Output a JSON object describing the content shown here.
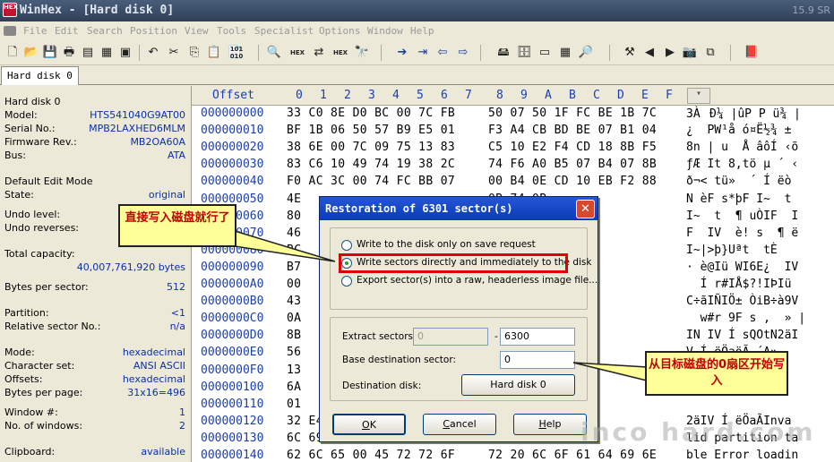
{
  "window": {
    "title": "WinHex - [Hard disk 0]",
    "version": "15.9 SR",
    "app_icon_text": "HEX"
  },
  "menu": [
    "File",
    "Edit",
    "Search",
    "Position",
    "View",
    "Tools",
    "Specialist",
    "Options",
    "Window",
    "Help"
  ],
  "tab": {
    "label": "Hard disk 0"
  },
  "left_panel": {
    "heading": "Hard disk 0",
    "rows": [
      {
        "label": "Model:",
        "value": "HTS541040G9AT00"
      },
      {
        "label": "Serial No.:",
        "value": "MPB2LAXHED6MLM"
      },
      {
        "label": "Firmware Rev.:",
        "value": "MB2OA60A"
      },
      {
        "label": "Bus:",
        "value": "ATA"
      },
      {
        "label": "Default Edit Mode",
        "value": ""
      },
      {
        "label": "State:",
        "value": "original"
      },
      {
        "label": "Undo level:",
        "value": ""
      },
      {
        "label": "Undo reverses:",
        "value": ""
      },
      {
        "label": "Total capacity:",
        "value": ""
      },
      {
        "label": "",
        "value": "40,007,761,920 bytes"
      },
      {
        "label": "Bytes per sector:",
        "value": "512"
      },
      {
        "label": "Partition:",
        "value": "<1"
      },
      {
        "label": "Relative sector No.:",
        "value": "n/a"
      },
      {
        "label": "Mode:",
        "value": "hexadecimal"
      },
      {
        "label": "Character set:",
        "value": "ANSI ASCII"
      },
      {
        "label": "Offsets:",
        "value": "hexadecimal"
      },
      {
        "label": "Bytes per page:",
        "value": "31x16=496"
      },
      {
        "label": "Window #:",
        "value": "1"
      },
      {
        "label": "No. of windows:",
        "value": "2"
      },
      {
        "label": "Clipboard:",
        "value": "available"
      }
    ]
  },
  "hex": {
    "offset_header": "Offset",
    "columns": [
      "0",
      "1",
      "2",
      "3",
      "4",
      "5",
      "6",
      "7",
      "8",
      "9",
      "A",
      "B",
      "C",
      "D",
      "E",
      "F"
    ],
    "rows": [
      {
        "offset": "000000000",
        "hex_left": "33 C0 8E D0 BC 00 7C FB",
        "hex_right": "50 07 50 1F FC BE 1B 7C",
        "ascii": "3ÀĐ¼ |ûP P ü¾ |"
      },
      {
        "offset": "000000010",
        "hex_left": "BF 1B 06 50 57 B9 E5 01",
        "hex_right": "F3 A4 CB BD BE 07 B1 04",
        "ascii": "¿  PW¹å ó¤Ë½¾ ±"
      },
      {
        "offset": "000000020",
        "hex_left": "38 6E 00 7C 09 75 13 83",
        "hex_right": "C5 10 E2 F4 CD 18 8B F5",
        "ascii": "8n | u  Å âôÍ ‹õ"
      },
      {
        "offset": "000000030",
        "hex_left": "83 C6 10 49 74 19 38 2C",
        "hex_right": "74 F6 A0 B5 07 B4 07 8B",
        "ascii": "ƒÆ It 8,tö µ ´ ‹"
      },
      {
        "offset": "000000040",
        "hex_left": "F0 AC 3C 00 74 FC BB 07",
        "hex_right": "00 B4 0E CD 10 EB F2 88",
        "ascii": "ð¬< tü»  ´ Í ëò"
      },
      {
        "offset": "000000050",
        "hex_left": "4E",
        "hex_right": "0B 74 0B",
        "ascii": "N èF s*þF I~  t"
      },
      {
        "offset": "000000060",
        "hex_left": "80",
        "hex_right": "02 06 83",
        "ascii": "I~  t  ¶ uÒIF  I"
      },
      {
        "offset": "000000070",
        "hex_left": "46",
        "hex_right": "B6 07 EB",
        "ascii": "F  IV  è! s  ¶ ë"
      },
      {
        "offset": "000000080",
        "hex_left": "BC",
        "hex_right": "74 C8 A0",
        "ascii": "I~|>þ}Uªt  tÈ "
      },
      {
        "offset": "000000090",
        "hex_left": "B7",
        "hex_right": "00 8A 56",
        "ascii": "· è@Iü WI6E¿  IV"
      },
      {
        "offset": "0000000A0",
        "hex_left": "00",
        "hex_right": "DE 8A FC",
        "ascii": "  Í r#IÅ$?!IÞIü"
      },
      {
        "offset": "0000000B0",
        "hex_left": "43",
        "hex_right": "F7 E1 8B",
        "ascii": "C÷ãIÑIÖ± ÒiB÷à9V"
      },
      {
        "offset": "0000000C0",
        "hex_left": "0A",
        "hex_right": "BB 00 7C",
        "ascii": "  w#r 9F s ,  » |"
      },
      {
        "offset": "0000000D0",
        "hex_left": "8B",
        "hex_right": "32 E4 8A",
        "ascii": "IN IV Í sQOtN2äI"
      },
      {
        "offset": "0000000E0",
        "hex_left": "56",
        "hex_right": "B4 41 BB",
        "ascii": "V Í ëÖaöÃ ´A»"
      },
      {
        "offset": "0000000F0",
        "hex_left": "13",
        "hex_right": "13",
        "ascii": "Ã a"
      },
      {
        "offset": "000000100",
        "hex_left": "6A",
        "hex_right": "",
        "ascii": "Ij"
      },
      {
        "offset": "000000110",
        "hex_left": "01",
        "hex_right": "",
        "ascii": ""
      },
      {
        "offset": "000000120",
        "hex_left": "32 E4 8A 56 00 CD 13 EB",
        "hex_right": "4E 76 61 ",
        "ascii": "2äIV Í ëÖaÃInva"
      },
      {
        "offset": "000000130",
        "hex_left": "6C 69 64 20 70 61 72 74",
        "hex_right": "69 74 69 ",
        "ascii": "lid partition ta"
      },
      {
        "offset": "000000140",
        "hex_left": "62 6C 65 00 45 72 72 6F",
        "hex_right": "72 20 6C 6F 61 64 69 6E",
        "ascii": "ble Error loadin"
      }
    ]
  },
  "dialog": {
    "title": "Restoration of 6301 sector(s)",
    "options": [
      {
        "label": "Write to the disk only on save request",
        "selected": false
      },
      {
        "label": "Write sectors directly and immediately to the disk",
        "selected": true
      },
      {
        "label": "Export sector(s) into a raw, headerless image file...",
        "selected": false
      }
    ],
    "extract_label": "Extract sectors",
    "extract_from": "0",
    "extract_dash": "-",
    "extract_to": "6300",
    "base_label": "Base destination sector:",
    "base_value": "0",
    "dest_label": "Destination disk:",
    "dest_button": "Hard disk 0",
    "ok": "OK",
    "cancel": "Cancel",
    "help": "Help"
  },
  "callouts": {
    "left": "直接写入磁盘就行了",
    "right": "从目标磁盘的0扇区开始写入"
  },
  "watermark": "inco hard.com"
}
